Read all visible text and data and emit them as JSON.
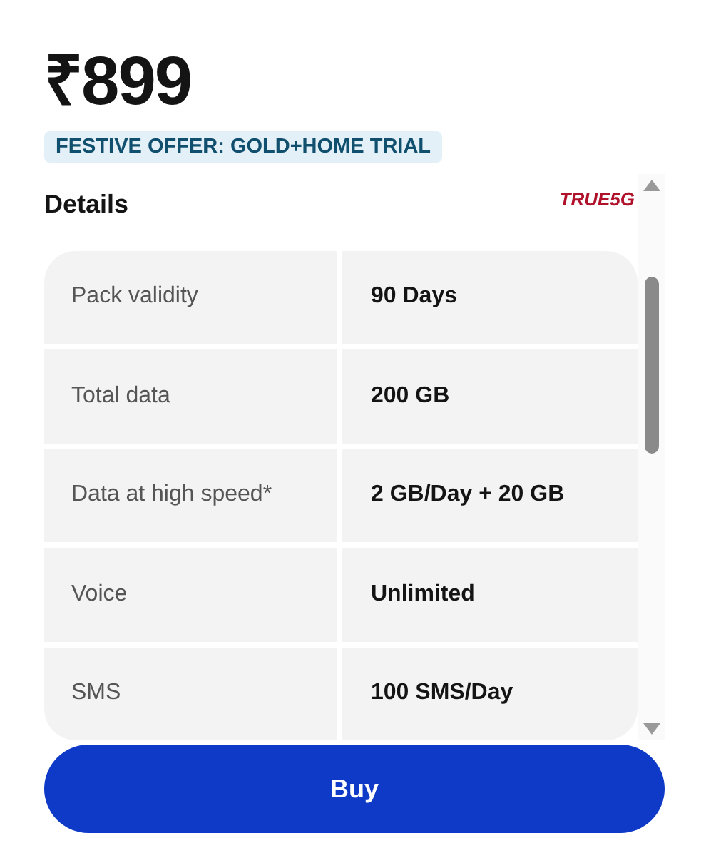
{
  "price": "₹899",
  "offer": "FESTIVE OFFER: GOLD+HOME TRIAL",
  "details": {
    "title": "Details",
    "badge": "TRUE5G",
    "rows": [
      {
        "label": "Pack validity",
        "value": "90 Days"
      },
      {
        "label": "Total data",
        "value": "200 GB"
      },
      {
        "label": "Data at high speed*",
        "value": "2 GB/Day + 20 GB"
      },
      {
        "label": "Voice",
        "value": "Unlimited"
      },
      {
        "label": "SMS",
        "value": "100 SMS/Day"
      }
    ]
  },
  "button": "Buy"
}
